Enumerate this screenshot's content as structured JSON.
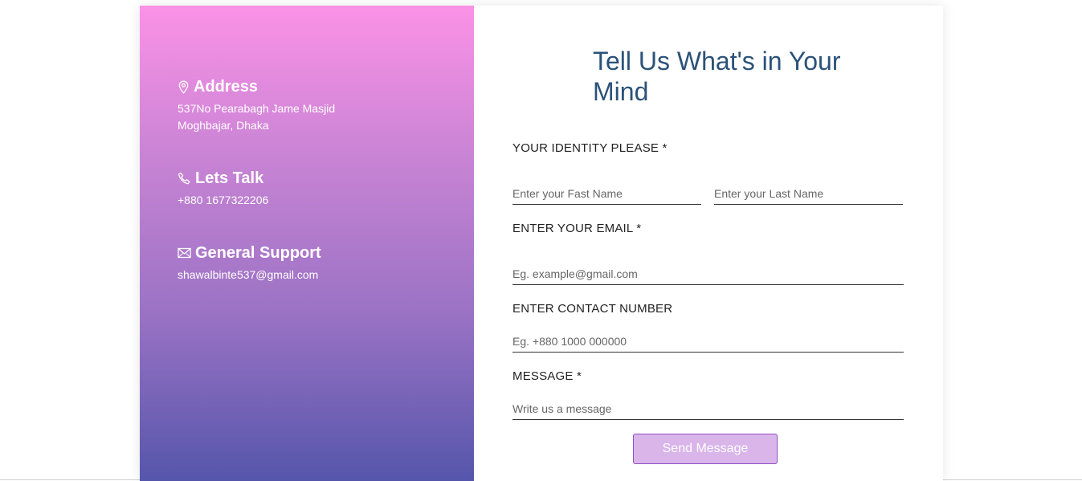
{
  "contact_info": {
    "address": {
      "icon": "map-pin-icon",
      "heading": "Address",
      "line1": "537No Pearabagh Jame Masjid",
      "line2": "Moghbajar, Dhaka"
    },
    "talk": {
      "icon": "phone-icon",
      "heading": "Lets Talk",
      "phone": "+880 1677322206"
    },
    "support": {
      "icon": "envelope-icon",
      "heading": "General Support",
      "email": "shawalbinte537@gmail.com"
    }
  },
  "form": {
    "title": "Tell Us What's in Your Mind",
    "identity_label": "YOUR IDENTITY PLEASE *",
    "first_name_placeholder": "Enter your Fast Name",
    "last_name_placeholder": "Enter your Last Name",
    "email_label": "ENTER YOUR EMAIL *",
    "email_placeholder": "Eg. example@gmail.com",
    "contact_label": "ENTER CONTACT NUMBER",
    "contact_placeholder": "Eg. +880 1000 000000",
    "message_label": "MESSAGE *",
    "message_placeholder": "Write us a message",
    "send_label": "Send Message"
  },
  "colors": {
    "gradient_top": "#fb92e6",
    "gradient_bottom": "#5556ab",
    "title": "#2b5279",
    "button_bg": "#d9b5ea",
    "button_border": "#9150c4"
  }
}
